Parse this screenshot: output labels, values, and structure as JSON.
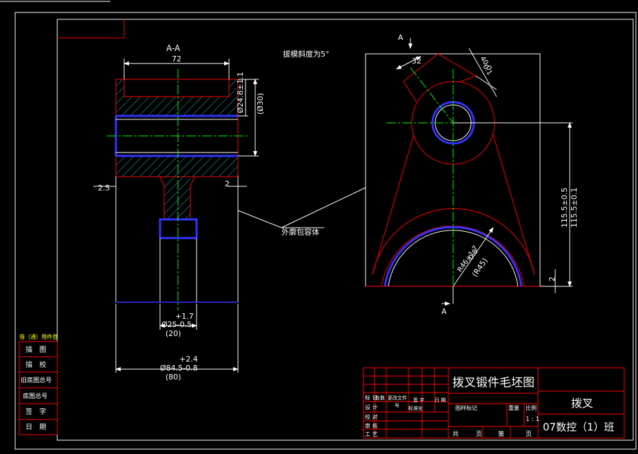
{
  "section_label": "A-A",
  "draft_note": "拔模斜度为5°",
  "outer_envelope_note": "外廓包容体",
  "section_marks": [
    "A",
    "A"
  ],
  "dims_left": {
    "width_top": "72",
    "bore_dia": "Ø24.8±1.1",
    "bore_ref": "(Ø30)",
    "step_left": "2.5",
    "step_right": "2",
    "shaft_tol_up": "+1.7",
    "shaft_dia": "Ø25-0.5",
    "shaft_ref": "(20)",
    "base_tol_up": "+2.4",
    "base_dia": "Ø84.5-0.8",
    "base_ref": "(80)"
  },
  "dims_right": {
    "angle": "32",
    "boss_a": "40.0",
    "boss_b": "0.1",
    "height_a": "115.5±0.5",
    "height_b": "115.5±0.1",
    "arc_r_a": "R46+1.7",
    "arc_r_b": "-0.8",
    "arc_r_ref": "(R45)",
    "bottom_gap": "2"
  },
  "left_table": {
    "header": "借（通）用件登",
    "rows": [
      "描　图",
      "描　校",
      "旧底图总号",
      "底图总号",
      "签　字",
      "日　期"
    ]
  },
  "title_block": {
    "drawing_title": "拨叉锻件毛坯图",
    "part_name": "拨叉",
    "class_name": "07数控（1）班",
    "row_labels": [
      "标 记",
      "设 计",
      "校 对",
      "审 核",
      "工 艺"
    ],
    "col_labels": [
      "处数",
      "更改文件",
      "号",
      "签 字",
      "日 期",
      "标准化"
    ],
    "stage_mark": "图样标记",
    "weight": "重量",
    "scale_label": "比例",
    "scale_value": "1 : 1",
    "total": "共",
    "sheet": "页",
    "page_no": "第",
    "page": "页"
  },
  "colors": {
    "frame": "#ffffff",
    "outline": "#ff0000",
    "center": "#00ff00",
    "blue": "#3333ff",
    "hatch": "#00cccc",
    "dim": "#ffffff"
  }
}
